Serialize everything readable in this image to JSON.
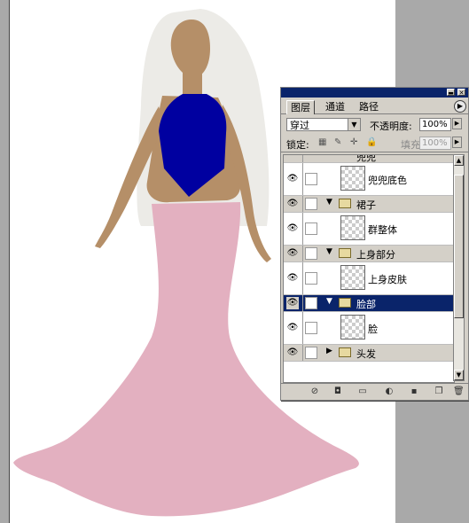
{
  "colors": {
    "veil": "#ecebe7",
    "skin": "#b58f68",
    "top": "#0000a0",
    "dress": "#e3b0c0",
    "selected_row": "#0a246a"
  },
  "panel": {
    "tabs": [
      "图层",
      "通道",
      "路径"
    ],
    "blend_mode": "穿过",
    "opacity_label": "不透明度:",
    "opacity_value": "100%",
    "lock_label": "锁定:",
    "fill_label": "填充:",
    "fill_value": "100%",
    "layers": [
      {
        "type": "group",
        "name": "兜兜"
      },
      {
        "type": "layer",
        "name": "兜兜底色"
      },
      {
        "type": "group",
        "name": "裙子"
      },
      {
        "type": "layer",
        "name": "群整体"
      },
      {
        "type": "group",
        "name": "上身部分"
      },
      {
        "type": "layer",
        "name": "上身皮肤"
      },
      {
        "type": "group",
        "name": "脸部",
        "selected": true
      },
      {
        "type": "layer",
        "name": "脸"
      },
      {
        "type": "group",
        "name": "头发",
        "collapsed": true
      }
    ],
    "icons": {
      "visibility": "eye-icon",
      "folder": "folder-icon",
      "menu": "panel-menu-arrow-icon"
    }
  }
}
